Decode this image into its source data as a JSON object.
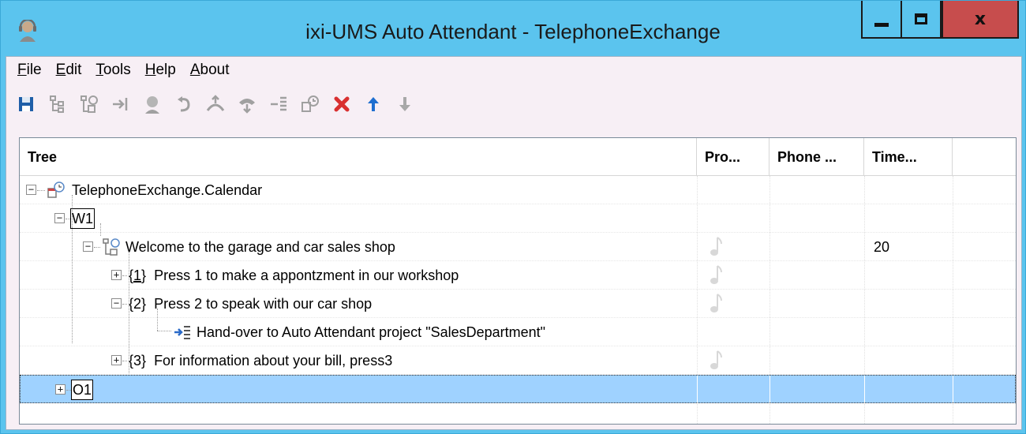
{
  "window": {
    "title": "ixi-UMS Auto Attendant - TelephoneExchange",
    "minimize_icon": "minimize-icon",
    "maximize_icon": "maximize-icon",
    "close_label": "x"
  },
  "menu": [
    {
      "accel": "F",
      "rest": "ile"
    },
    {
      "accel": "E",
      "rest": "dit"
    },
    {
      "accel": "T",
      "rest": "ools"
    },
    {
      "accel": "H",
      "rest": "elp"
    },
    {
      "accel": "A",
      "rest": "bout"
    }
  ],
  "toolbar": [
    "save-icon",
    "add-node-icon",
    "add-calendar-icon",
    "transfer-icon",
    "operator-icon",
    "back-icon",
    "hangup-icon",
    "call-icon",
    "handover-icon",
    "calendar-icon",
    "delete-icon",
    "move-up-icon",
    "move-down-icon"
  ],
  "columns": [
    "Tree",
    "Pro...",
    "Phone ...",
    "Time..."
  ],
  "rows": [
    {
      "label": "TelephoneExchange.Calendar",
      "prefix": "",
      "time": ""
    },
    {
      "label": "W1",
      "prefix": "",
      "time": ""
    },
    {
      "label": "Welcome to the garage and car sales shop",
      "prefix": "",
      "time": "20"
    },
    {
      "label": "Press 1 to make a appontzment in our workshop",
      "prefix": "{1}",
      "time": ""
    },
    {
      "label": "Press 2 to speak with our car shop",
      "prefix": "{2}",
      "time": ""
    },
    {
      "label": "Hand-over to Auto Attendant project \"SalesDepartment\"",
      "prefix": "",
      "time": ""
    },
    {
      "label": "For information about your bill, press3",
      "prefix": "{3}",
      "time": ""
    },
    {
      "label": "O1",
      "prefix": "",
      "time": ""
    }
  ],
  "colors": {
    "titlebar": "#5bc4ee",
    "close": "#c74d4d",
    "selected_row": "#9fd2ff"
  }
}
